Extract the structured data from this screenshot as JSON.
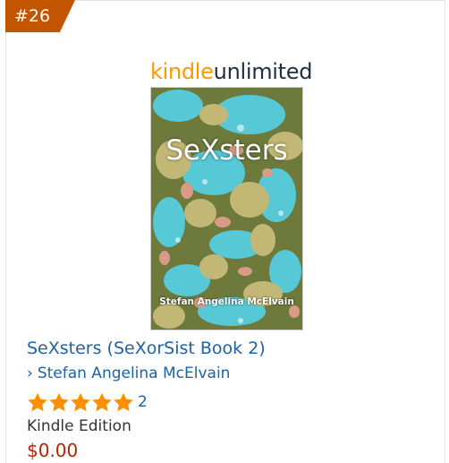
{
  "rank": "#26",
  "ku_logo": {
    "part1": "kindle",
    "part2": "unlimited"
  },
  "cover": {
    "title": "SeXsters",
    "author": "Stefan Angelina McElvain"
  },
  "product": {
    "title": "SeXsters (SeXorSist Book 2)",
    "author_chevron": "›",
    "author": "Stefan Angelina McElvain",
    "rating_out_of_5": 5,
    "review_count": "2",
    "format": "Kindle Edition",
    "price": "$0.00"
  },
  "colors": {
    "badge": "#c45500",
    "link": "#2162a1",
    "price": "#b12704",
    "star": "#ff8f00"
  },
  "icons": [
    "star-icon"
  ]
}
